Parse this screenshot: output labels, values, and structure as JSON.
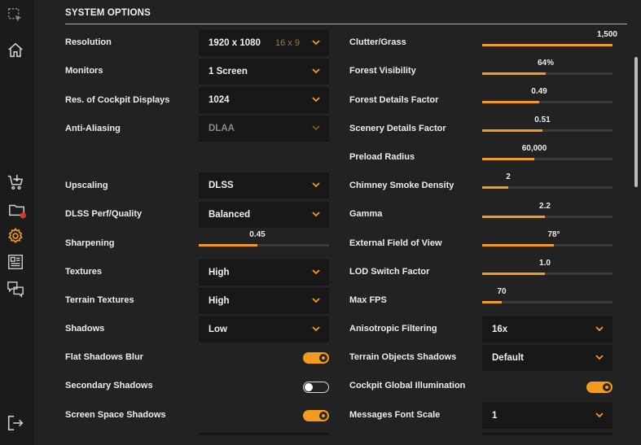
{
  "section_title": "SYSTEM OPTIONS",
  "colors": {
    "accent": "#f29c1f",
    "notification": "#d9312b"
  },
  "sidebar": {
    "icons": [
      "select-region-icon",
      "home-icon",
      "download-cart-icon",
      "folder-icon",
      "gear-icon",
      "news-icon",
      "chat-icon",
      "logout-icon"
    ]
  },
  "left": {
    "resolution": {
      "label": "Resolution",
      "value": "1920 x 1080",
      "aspect": "16 x 9"
    },
    "monitors": {
      "label": "Monitors",
      "value": "1 Screen"
    },
    "cockpit_displays": {
      "label": "Res. of Cockpit Displays",
      "value": "1024"
    },
    "anti_aliasing": {
      "label": "Anti-Aliasing",
      "value": "DLAA"
    },
    "upscaling": {
      "label": "Upscaling",
      "value": "DLSS"
    },
    "dlss_quality": {
      "label": "DLSS Perf/Quality",
      "value": "Balanced"
    },
    "sharpening": {
      "label": "Sharpening",
      "value": "0.45",
      "fraction": 0.45
    },
    "textures": {
      "label": "Textures",
      "value": "High"
    },
    "terrain_textures": {
      "label": "Terrain Textures",
      "value": "High"
    },
    "shadows": {
      "label": "Shadows",
      "value": "Low"
    },
    "flat_shadows_blur": {
      "label": "Flat Shadows Blur",
      "on": true
    },
    "secondary_shadows": {
      "label": "Secondary Shadows",
      "on": false
    },
    "screen_space_shadows": {
      "label": "Screen Space Shadows",
      "on": true
    }
  },
  "right": {
    "clutter": {
      "label": "Clutter/Grass",
      "value": "1,500",
      "fraction": 1.0
    },
    "forest_visibility": {
      "label": "Forest Visibility",
      "value": "64%",
      "fraction": 0.49
    },
    "forest_details": {
      "label": "Forest Details Factor",
      "value": "0.49",
      "fraction": 0.44
    },
    "scenery_details": {
      "label": "Scenery Details Factor",
      "value": "0.51",
      "fraction": 0.46
    },
    "preload_radius": {
      "label": "Preload Radius",
      "value": "60,000",
      "fraction": 0.4
    },
    "chimney_smoke": {
      "label": "Chimney Smoke Density",
      "value": "2",
      "fraction": 0.2
    },
    "gamma": {
      "label": "Gamma",
      "value": "2.2",
      "fraction": 0.48
    },
    "external_fov": {
      "label": "External Field of View",
      "value": "78°",
      "fraction": 0.55
    },
    "lod_switch": {
      "label": "LOD Switch Factor",
      "value": "1.0",
      "fraction": 0.48
    },
    "max_fps": {
      "label": "Max FPS",
      "value": "70",
      "fraction": 0.15
    },
    "anisotropic": {
      "label": "Anisotropic Filtering",
      "value": "16x"
    },
    "terrain_objects_shadows": {
      "label": "Terrain Objects Shadows",
      "value": "Default"
    },
    "cockpit_gi": {
      "label": "Cockpit Global Illumination",
      "on": true
    },
    "messages_font_scale": {
      "label": "Messages Font Scale",
      "value": "1"
    }
  }
}
